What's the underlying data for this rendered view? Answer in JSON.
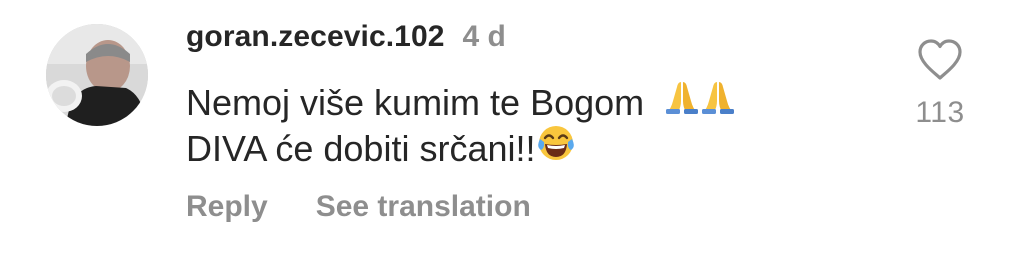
{
  "comment": {
    "username": "goran.zecevic.102",
    "timestamp": "4 d",
    "text_line1": "Nemoj više kumim te Bogom",
    "text_line2": "DIVA će dobiti srčani!!",
    "emojis": [
      "folded-hands-icon",
      "folded-hands-icon",
      "tears-of-joy-icon"
    ],
    "actions": {
      "reply": "Reply",
      "see_translation": "See translation"
    },
    "likes": {
      "icon": "heart-outline-icon",
      "count": "113"
    }
  },
  "colors": {
    "primary_text": "#262626",
    "secondary_text": "#8e8e8e",
    "background": "#ffffff"
  }
}
